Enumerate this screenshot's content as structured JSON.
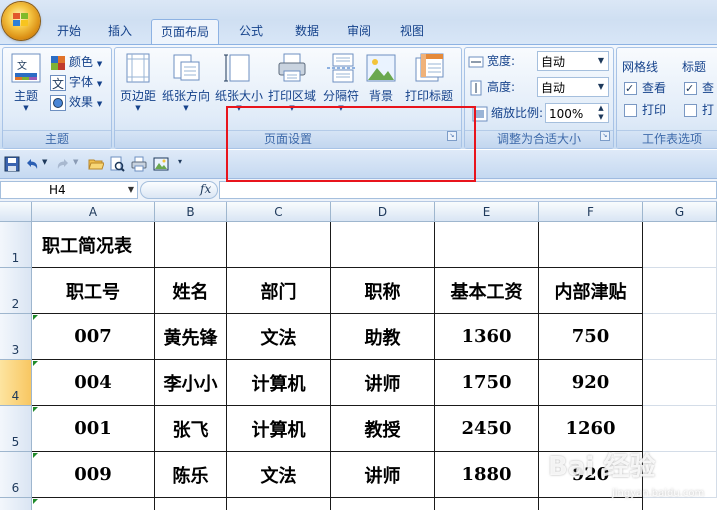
{
  "tabs": [
    {
      "label": "开始"
    },
    {
      "label": "插入"
    },
    {
      "label": "页面布局"
    },
    {
      "label": "公式"
    },
    {
      "label": "数据"
    },
    {
      "label": "审阅"
    },
    {
      "label": "视图"
    }
  ],
  "active_tab": "页面布局",
  "ribbon": {
    "themes": {
      "theme_label": "主题",
      "colors_label": "颜色",
      "fonts_label": "字体",
      "effects_label": "效果",
      "group_label": "主题"
    },
    "page_setup": {
      "margins_label": "页边距",
      "orientation_label": "纸张方向",
      "size_label": "纸张大小",
      "print_area_label": "打印区域",
      "breaks_label": "分隔符",
      "background_label": "背景",
      "print_titles_label": "打印标题",
      "group_label": "页面设置"
    },
    "scale_to_fit": {
      "width_label": "宽度:",
      "width_value": "自动",
      "height_label": "高度:",
      "height_value": "自动",
      "scale_label": "缩放比例:",
      "scale_value": "100%",
      "group_label": "调整为合适大小"
    },
    "sheet_options": {
      "gridlines_label": "网格线",
      "gridlines_view_label": "查看",
      "gridlines_print_label": "打印",
      "headings_label": "标题",
      "headings_view_label": "查",
      "headings_print_label": "打",
      "group_label": "工作表选项"
    }
  },
  "formula_bar": {
    "name_box": "H4",
    "fx_label": "fx",
    "content": ""
  },
  "sheet": {
    "columns": [
      "A",
      "B",
      "C",
      "D",
      "E",
      "F",
      "G"
    ],
    "rows": [
      "1",
      "2",
      "3",
      "4",
      "5",
      "6"
    ],
    "selected_row": "4",
    "cells": [
      [
        "职工简况表",
        "",
        "",
        "",
        "",
        ""
      ],
      [
        "职工号",
        "姓名",
        "部门",
        "职称",
        "基本工资",
        "内部津贴"
      ],
      [
        "007",
        "黄先锋",
        "文法",
        "助教",
        "1360",
        "750"
      ],
      [
        "004",
        "李小小",
        "计算机",
        "讲师",
        "1750",
        "920"
      ],
      [
        "001",
        "张飞",
        "计算机",
        "教授",
        "2450",
        "1260"
      ],
      [
        "009",
        "陈乐",
        "文法",
        "讲师",
        "1880",
        "920"
      ]
    ]
  },
  "watermark": {
    "text": "Bai  经验",
    "sub": "jingyan.baidu.com"
  },
  "colors": {
    "accent": "#15428b",
    "highlight_box": "#e8141c",
    "selected_row_header": "#f8c762"
  }
}
